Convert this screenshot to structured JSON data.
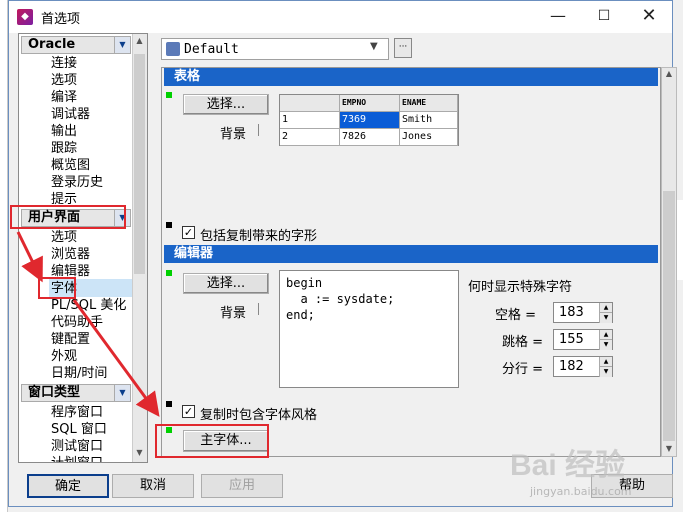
{
  "window": {
    "title": "首选项",
    "controls": {
      "minimize": "—",
      "maximize": "☐",
      "close": "✕"
    }
  },
  "nav": {
    "categories": [
      {
        "label": "Oracle",
        "items": [
          "连接",
          "选项",
          "编译",
          "调试器",
          "输出",
          "跟踪",
          "概览图",
          "登录历史",
          "提示"
        ]
      },
      {
        "label": "用户界面",
        "items": [
          "选项",
          "浏览器",
          "编辑器",
          "字体",
          "PL/SQL 美化",
          "代码助手",
          "键配置",
          "外观",
          "日期/时间"
        ]
      },
      {
        "label": "窗口类型",
        "items": [
          "程序窗口",
          "SQL 窗口",
          "测试窗口",
          "计划窗口"
        ]
      }
    ],
    "selected": "字体"
  },
  "preset": {
    "value": "Default",
    "more": "···"
  },
  "grid_section": {
    "title": "表格",
    "select_button": "选择...",
    "background_label": "背景",
    "columns": [
      "EMPNO",
      "ENAME"
    ],
    "rows": [
      {
        "num": "1",
        "empno": "7369",
        "ename": "Smith"
      },
      {
        "num": "2",
        "empno": "7826",
        "ename": "Jones"
      }
    ],
    "copy_checkbox_label": "包括复制带来的字形",
    "copy_checked": true
  },
  "editor_section": {
    "title": "编辑器",
    "select_button": "选择...",
    "background_label": "背景",
    "code_text": "begin\n  a := sysdate;\nend;",
    "special_chars_label": "何时显示特殊字符",
    "spinners": [
      {
        "label": "空格 =",
        "value": "183"
      },
      {
        "label": "跳格 =",
        "value": "155"
      },
      {
        "label": "分行 =",
        "value": "182"
      }
    ],
    "copy_checkbox_label": "复制时包含字体风格",
    "copy_checked": true
  },
  "main_font_button": "主字体...",
  "buttons": {
    "ok": "确定",
    "cancel": "取消",
    "apply": "应用",
    "help": "帮助"
  },
  "colors": {
    "section_header": "#1a64c8",
    "annotation_red": "#e0282e",
    "green_marker": "#00d000"
  },
  "watermark": {
    "main": "Bai 经验",
    "sub": "jingyan.baidu.com"
  }
}
